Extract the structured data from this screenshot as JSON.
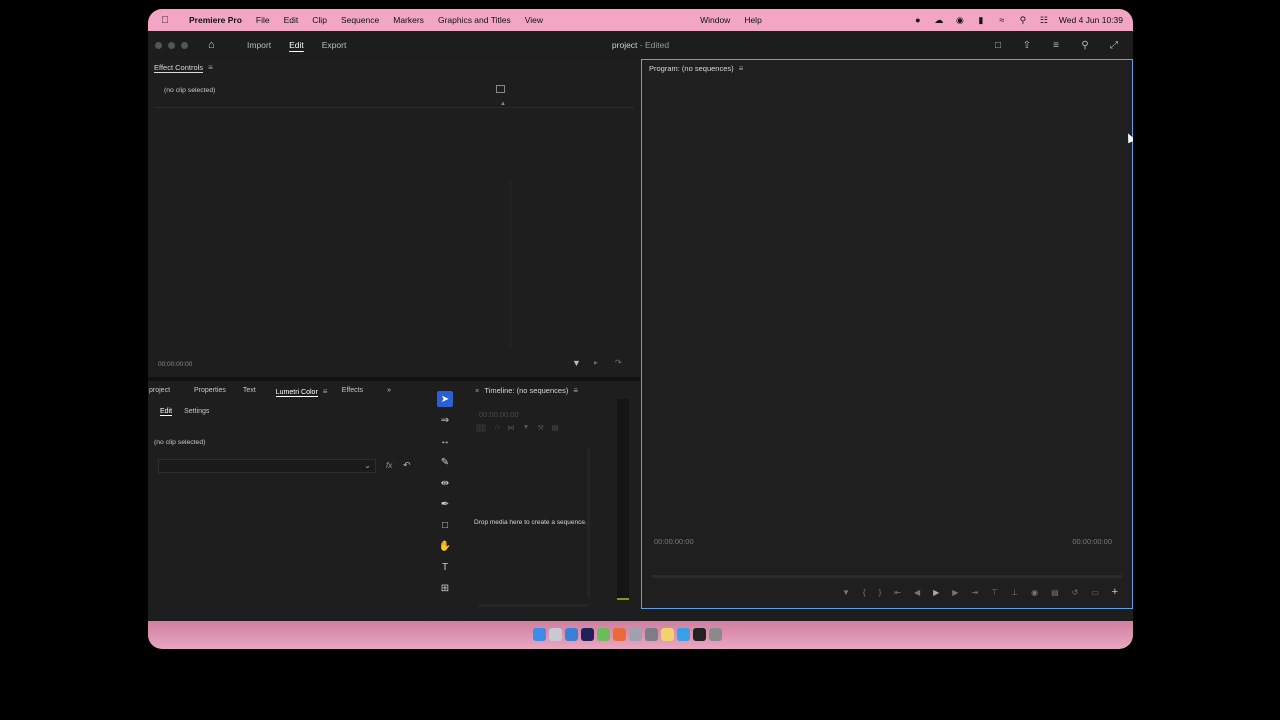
{
  "menubar": {
    "app": "Premiere Pro",
    "items": [
      "File",
      "Edit",
      "Clip",
      "Sequence",
      "Markers",
      "Graphics and Titles",
      "View"
    ],
    "right_items": [
      "Window",
      "Help"
    ],
    "clock": "Wed 4 Jun  10:39"
  },
  "header": {
    "nav": [
      "Import",
      "Edit",
      "Export"
    ],
    "active_nav": "Edit",
    "title": "project",
    "title_status": " - Edited"
  },
  "effect_controls": {
    "title": "Effect Controls",
    "no_clip": "(no clip selected)",
    "timecode": "00:00:00:00"
  },
  "left_tabs": {
    "tabs": [
      "project",
      "Properties",
      "Text",
      "Lumetri Color",
      "Effects"
    ],
    "active": "Lumetri Color",
    "subtabs": [
      "Edit",
      "Settings"
    ],
    "no_clip": "(no clip selected)",
    "fx_label": "fx"
  },
  "timeline": {
    "title": "Timeline: (no sequences)",
    "timecode": "00:00:00:00",
    "drop_text": "Drop media here to create a sequence."
  },
  "program": {
    "title": "Program: (no sequences)",
    "timecode_left": "00:00:00:00",
    "timecode_right": "00:00:00:00"
  },
  "colors": {
    "menubar": "#f2a6c4",
    "accent": "#2b5fd6",
    "monitor_border": "#5aa2e6"
  }
}
